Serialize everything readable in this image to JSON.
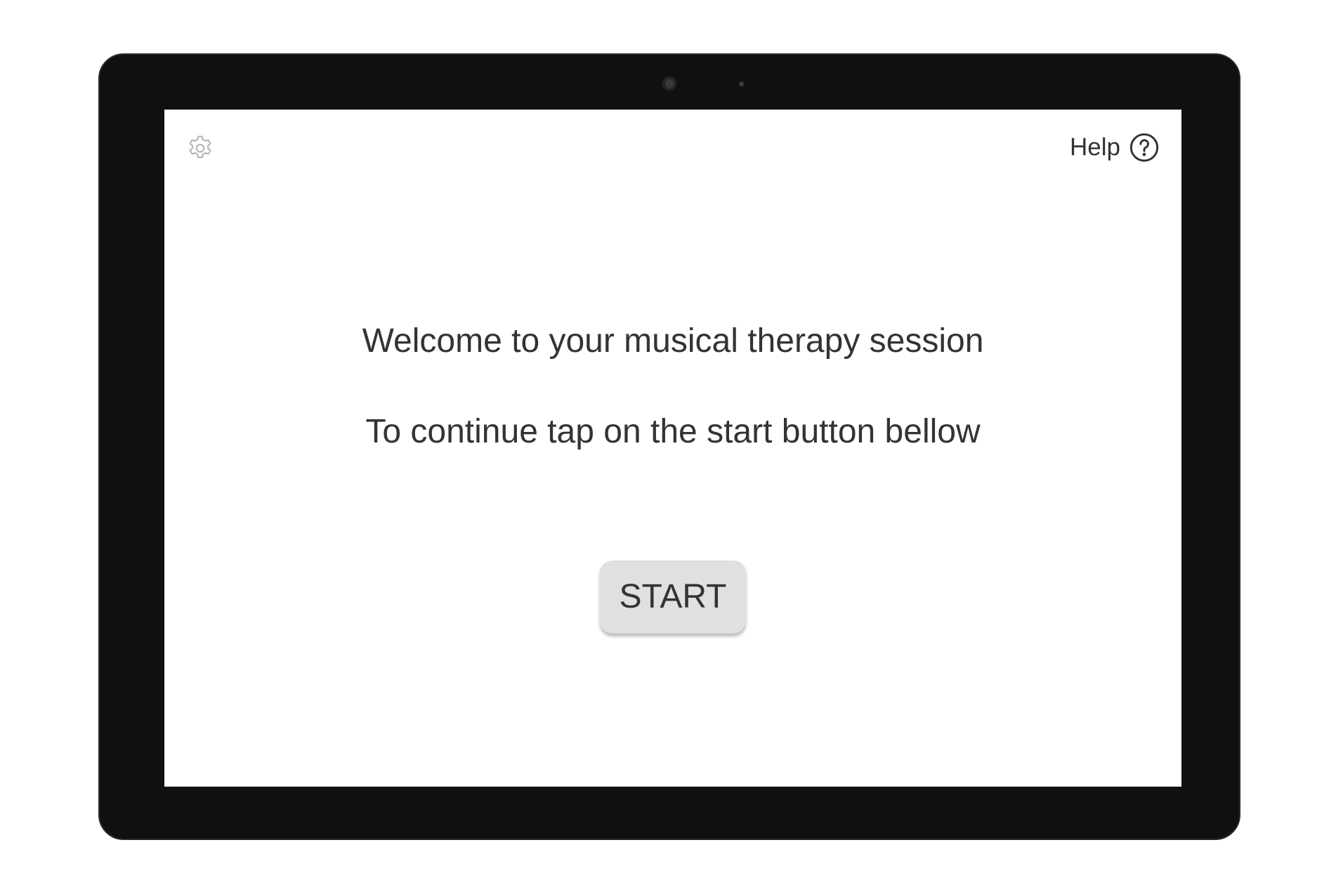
{
  "header": {
    "settings_icon": "gear-icon",
    "help_label": "Help",
    "help_icon": "question-circle-icon"
  },
  "main": {
    "welcome_text": "Welcome to your musical therapy session",
    "instruction_text": "To continue tap on the start button bellow",
    "start_label": "START"
  },
  "colors": {
    "text": "#333333",
    "button_bg": "#e0e0e0",
    "settings_icon": "#b5b5b5",
    "bezel": "#101010",
    "screen_bg": "#ffffff"
  }
}
